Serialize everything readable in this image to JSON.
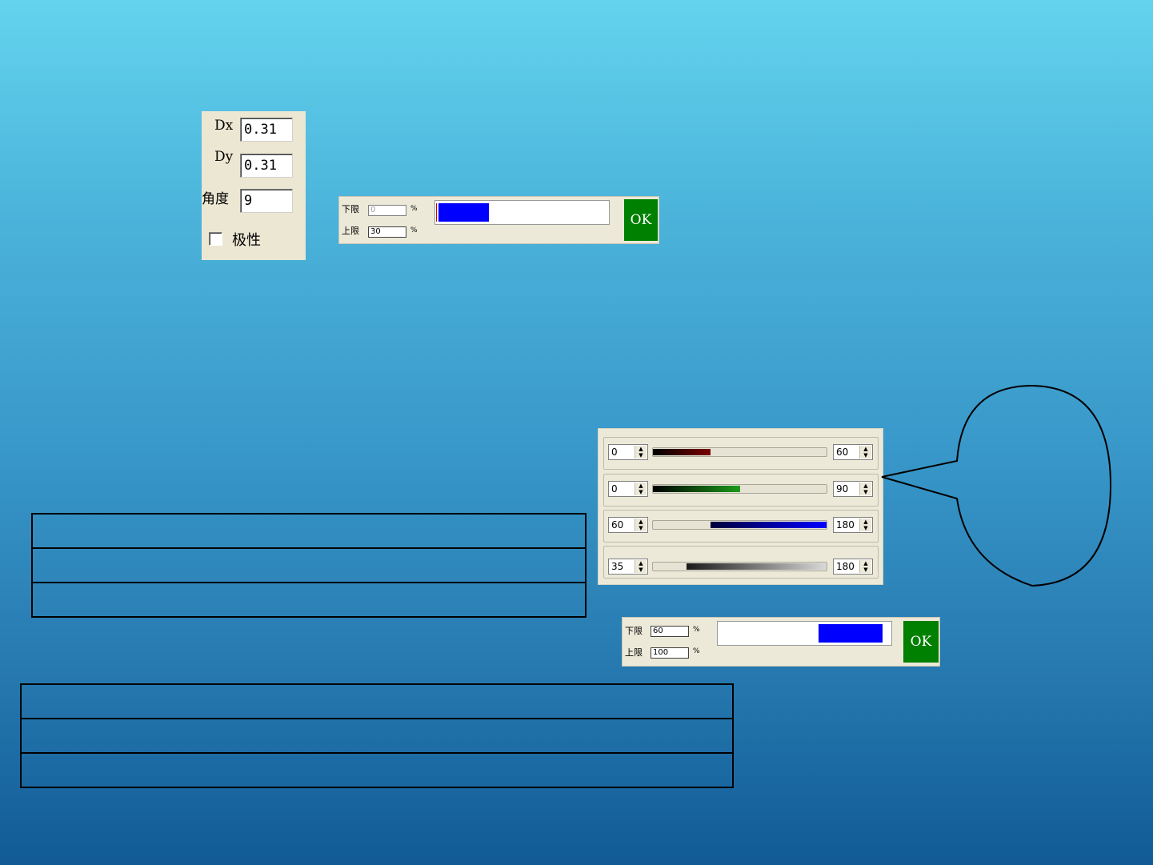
{
  "params": {
    "dx_label": "Dx",
    "dx_value": "0.31",
    "dy_label": "Dy",
    "dy_value": "0.31",
    "angle_label": "角度",
    "angle_value": "9",
    "polarity_label": "极性",
    "polarity_checked": false
  },
  "threshold_top": {
    "lower_label": "下限",
    "lower_value": "0",
    "upper_label": "上限",
    "upper_value": "30",
    "percent": "%",
    "ok_label": "OK",
    "fill_start": 0,
    "fill_end": 30
  },
  "threshold_bottom": {
    "lower_label": "下限",
    "lower_value": "60",
    "upper_label": "上限",
    "upper_value": "100",
    "percent": "%",
    "ok_label": "OK",
    "fill_start": 60,
    "fill_end": 100
  },
  "color_ranges": [
    {
      "min": "0",
      "max": "60",
      "channel": "red",
      "start": 0,
      "end": 60,
      "scale": 180
    },
    {
      "min": "0",
      "max": "90",
      "channel": "green",
      "start": 0,
      "end": 90,
      "scale": 180
    },
    {
      "min": "60",
      "max": "180",
      "channel": "blue",
      "start": 60,
      "end": 180,
      "scale": 180
    },
    {
      "min": "35",
      "max": "180",
      "channel": "gray",
      "start": 35,
      "end": 180,
      "scale": 180
    }
  ],
  "colors": {
    "ok_button": "#008000",
    "fill_blue": "#0000ff"
  },
  "icons": {
    "spin_arrows": "up-down-arrows-icon",
    "checkbox": "checkbox-icon"
  }
}
